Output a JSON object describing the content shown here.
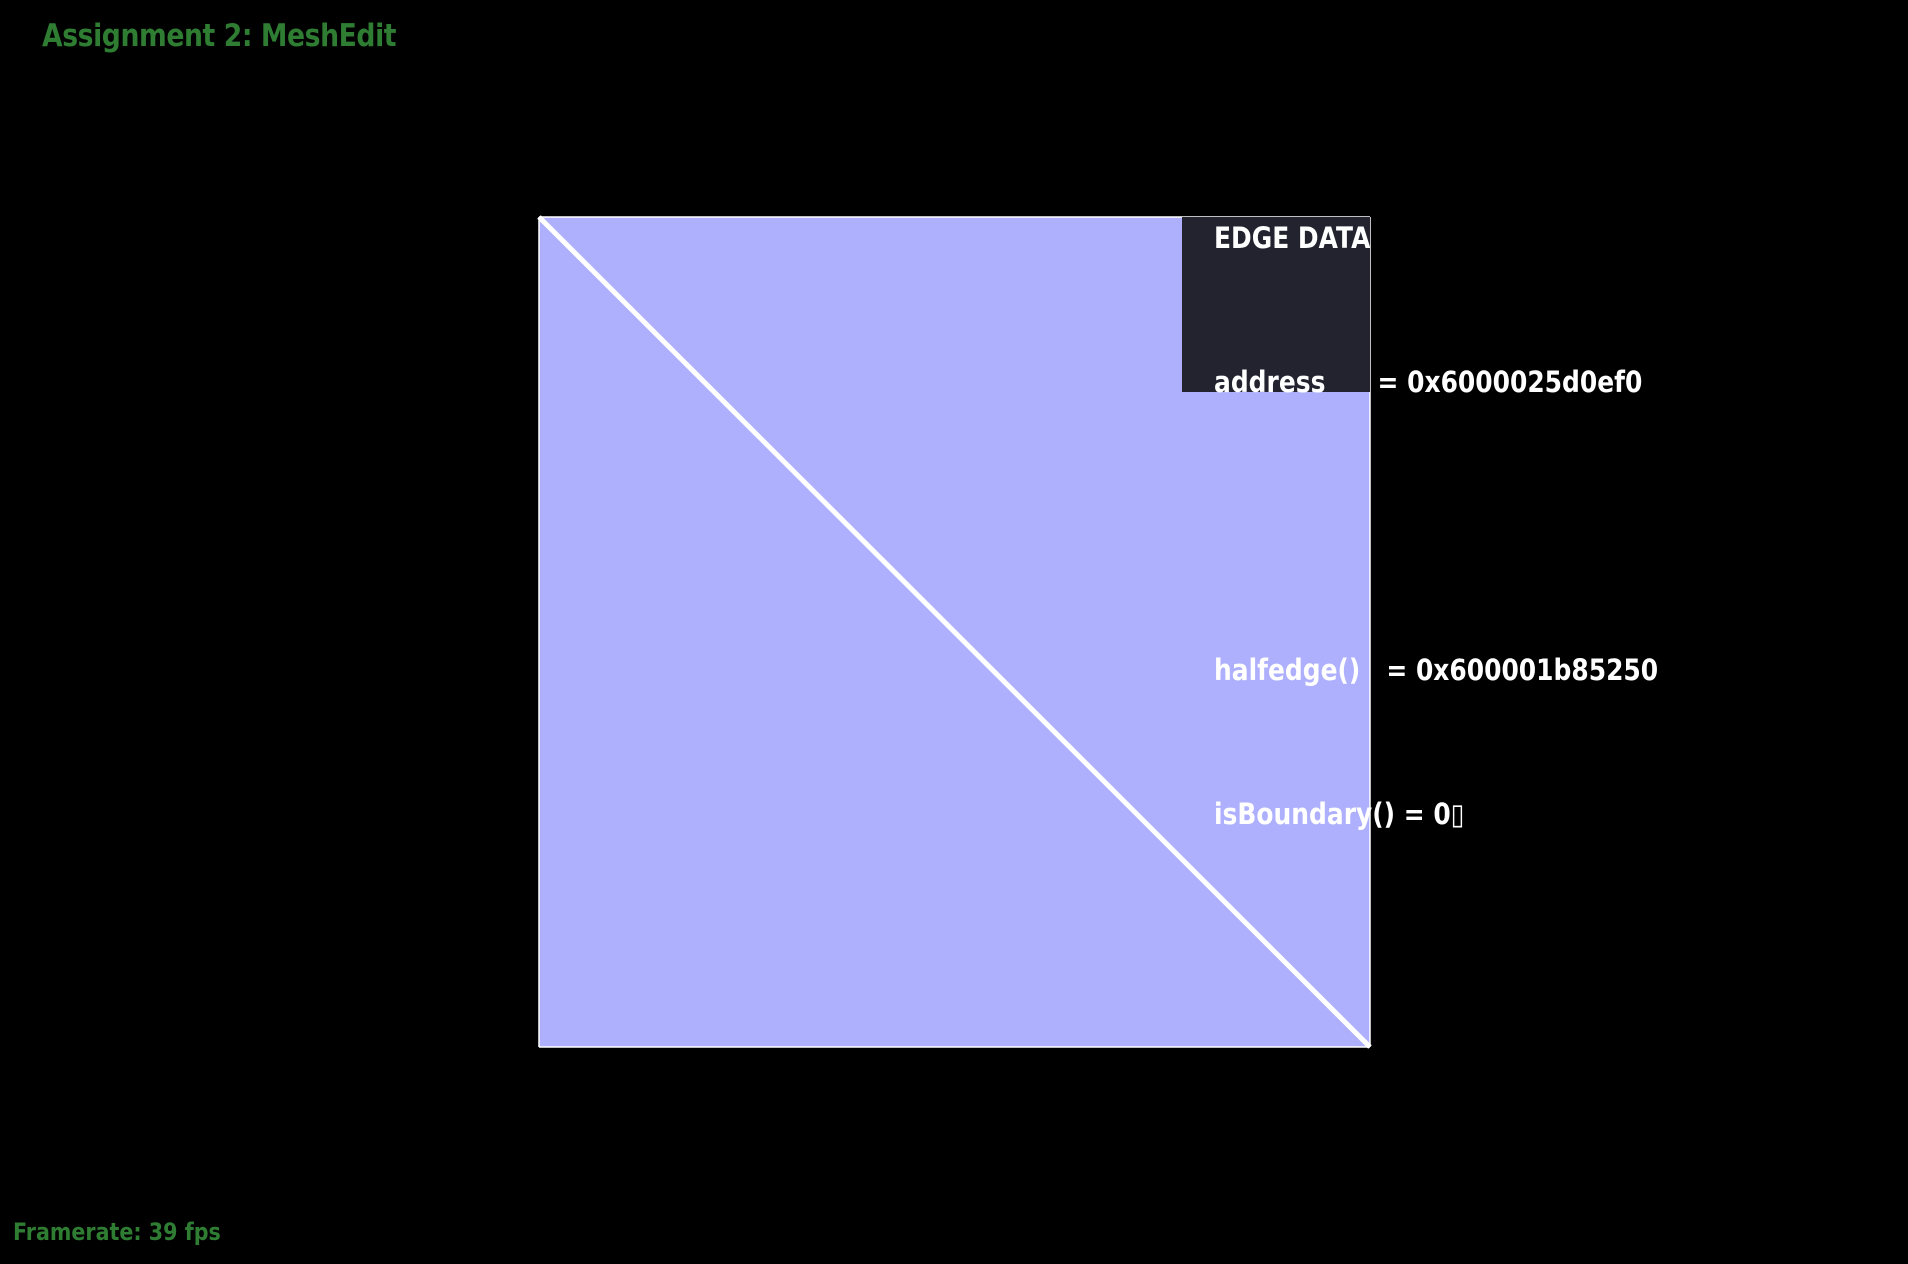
{
  "app": {
    "title": "Assignment 2: MeshEdit",
    "accent_color": "#2e7d32"
  },
  "status": {
    "framerate_text": "Framerate: 39 fps"
  },
  "mesh": {
    "face_color": "#aeb0fd",
    "edge_color": "#ffffff",
    "selected_edge": "diagonal"
  },
  "edge_data": {
    "heading": "EDGE DATA",
    "rows": [
      {
        "label": "address      ",
        "value": "= 0x6000025d0ef0"
      },
      {
        "label": "",
        "value": ""
      },
      {
        "label": "halfedge()   ",
        "value": "= 0x600001b85250"
      },
      {
        "label": "isBoundary() ",
        "value": "= 0▯"
      }
    ]
  }
}
